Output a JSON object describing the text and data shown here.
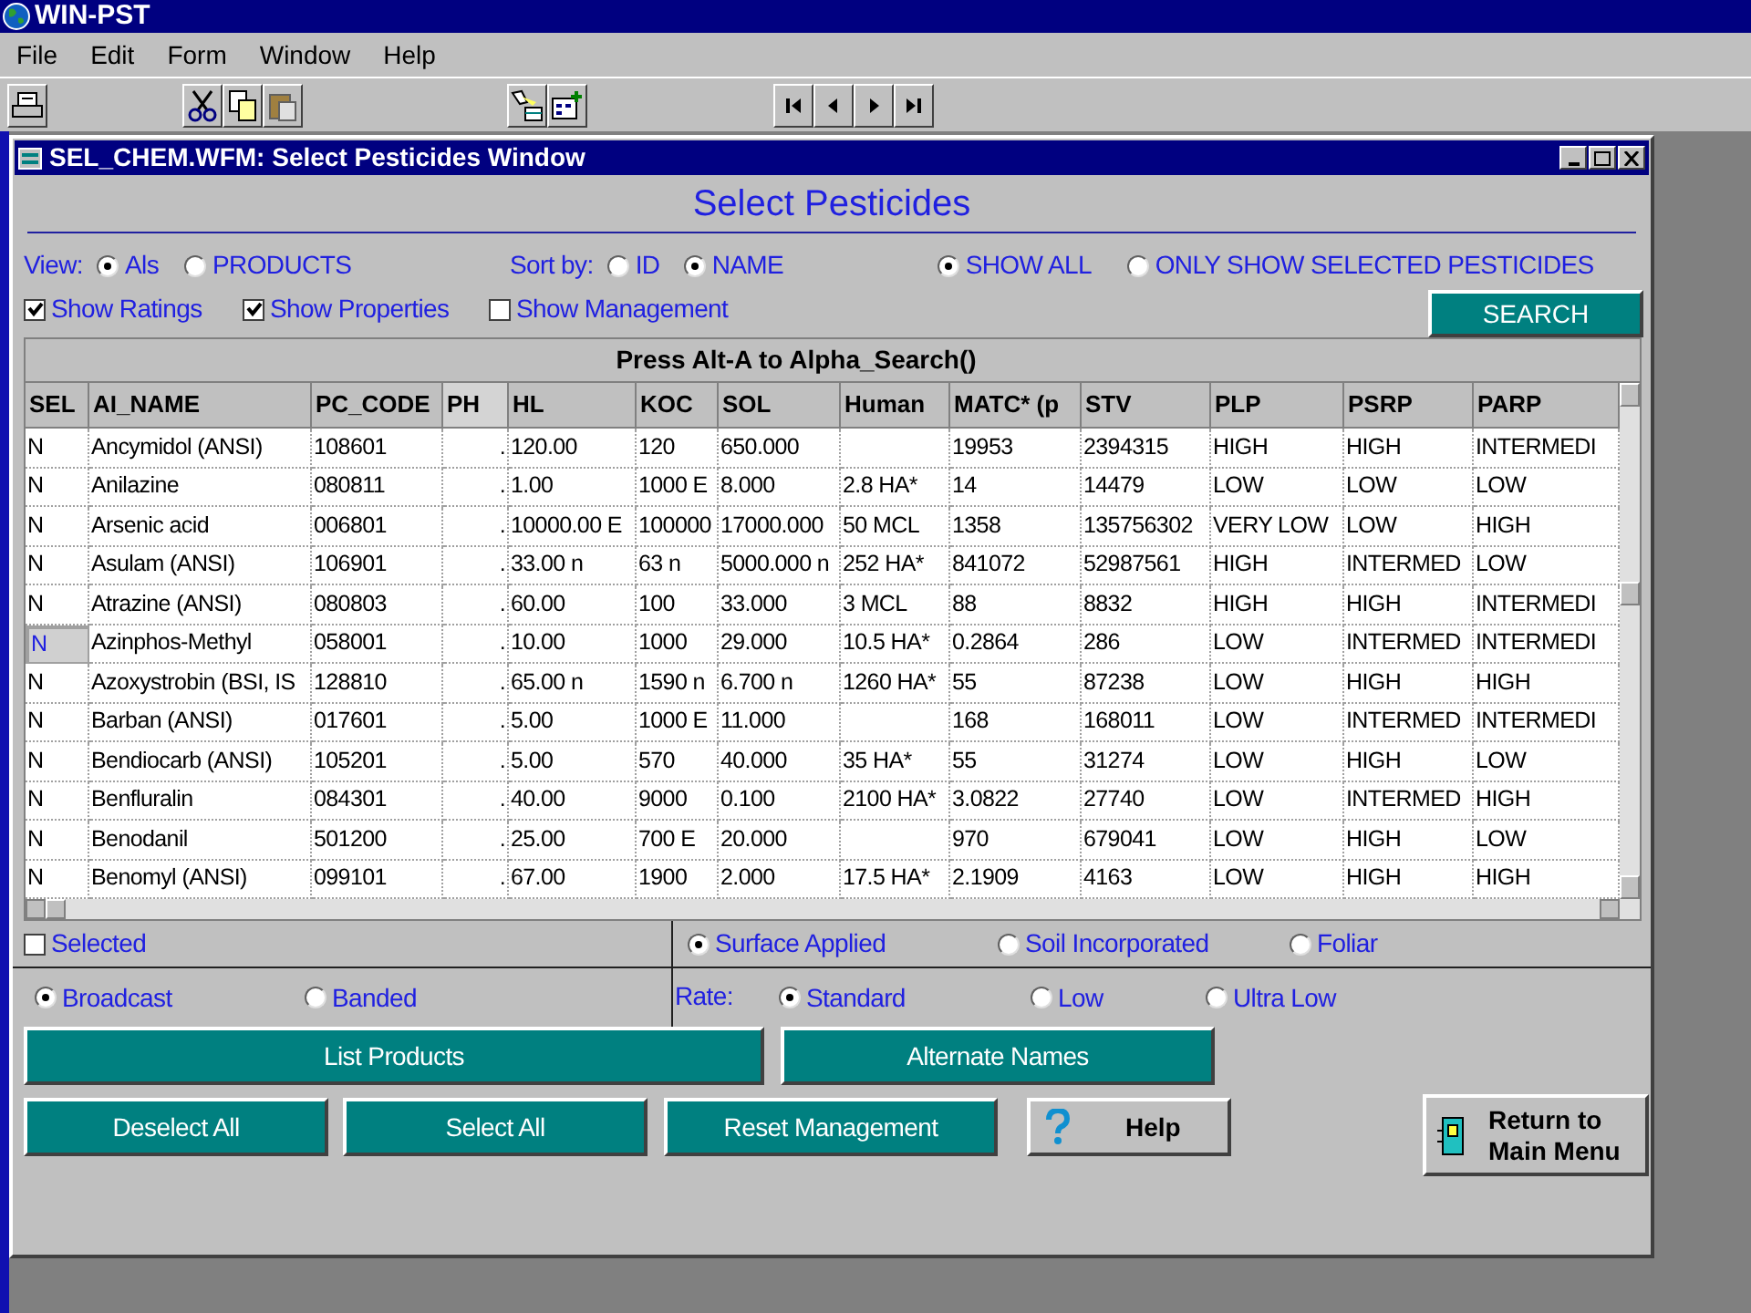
{
  "app": {
    "title": "WIN-PST"
  },
  "menu": [
    "File",
    "Edit",
    "Form",
    "Window",
    "Help"
  ],
  "window": {
    "title": "SEL_CHEM.WFM: Select Pesticides Window",
    "heading": "Select Pesticides"
  },
  "view": {
    "label": "View:",
    "options": [
      {
        "label": "Als",
        "selected": true
      },
      {
        "label": "PRODUCTS",
        "selected": false
      }
    ]
  },
  "sort": {
    "label": "Sort by:",
    "options": [
      {
        "label": "ID",
        "selected": false
      },
      {
        "label": "NAME",
        "selected": true
      }
    ]
  },
  "show": {
    "options": [
      {
        "label": "SHOW ALL",
        "selected": true
      },
      {
        "label": "ONLY SHOW SELECTED PESTICIDES",
        "selected": false
      }
    ]
  },
  "checkboxes": [
    {
      "label": "Show Ratings",
      "checked": true
    },
    {
      "label": "Show Properties",
      "checked": true
    },
    {
      "label": "Show Management",
      "checked": false
    }
  ],
  "search_button": "SEARCH",
  "grid": {
    "caption": "Press Alt-A to Alpha_Search()",
    "columns": [
      "SEL",
      "AI_NAME",
      "PC_CODE",
      "PH",
      "HL",
      "KOC",
      "SOL",
      "Human",
      "MATC* (p",
      "STV",
      "PLP",
      "PSRP",
      "PARP"
    ],
    "rows": [
      {
        "current": false,
        "cells": [
          "N",
          "Ancymidol (ANSI)",
          "108601",
          ".",
          "120.00",
          "120",
          "650.000",
          null,
          "19953",
          "2394315",
          "HIGH",
          "HIGH",
          "INTERMEDI"
        ]
      },
      {
        "current": false,
        "cells": [
          "N",
          "Anilazine",
          "080811",
          ".",
          "1.00",
          "1000 E",
          "8.000",
          "2.8 HA*",
          "14",
          "14479",
          "LOW",
          "LOW",
          "LOW"
        ]
      },
      {
        "current": false,
        "cells": [
          "N",
          "Arsenic acid",
          "006801",
          ".",
          "10000.00 E",
          "100000",
          "17000.000",
          "50 MCL",
          "1358",
          "135756302",
          "VERY LOW",
          "LOW",
          "HIGH"
        ]
      },
      {
        "current": false,
        "cells": [
          "N",
          "Asulam (ANSI)",
          "106901",
          ".",
          "33.00 n",
          "63 n",
          "5000.000 n",
          "252 HA*",
          "841072",
          "52987561",
          "HIGH",
          "INTERMED",
          "LOW"
        ]
      },
      {
        "current": false,
        "cells": [
          "N",
          "Atrazine (ANSI)",
          "080803",
          ".",
          "60.00",
          "100",
          "33.000",
          "3 MCL",
          "88",
          "8832",
          "HIGH",
          "HIGH",
          "INTERMEDI"
        ]
      },
      {
        "current": true,
        "cells": [
          "N",
          "Azinphos-Methyl",
          "058001",
          ".",
          "10.00",
          "1000",
          "29.000",
          "10.5 HA*",
          "0.2864",
          "286",
          "LOW",
          "INTERMED",
          "INTERMEDI"
        ]
      },
      {
        "current": false,
        "cells": [
          "N",
          "Azoxystrobin (BSI, IS",
          "128810",
          ".",
          "65.00 n",
          "1590 n",
          "6.700 n",
          "1260 HA*",
          "55",
          "87238",
          "LOW",
          "HIGH",
          "HIGH"
        ]
      },
      {
        "current": false,
        "cells": [
          "N",
          "Barban (ANSI)",
          "017601",
          ".",
          "5.00",
          "1000 E",
          "11.000",
          null,
          "168",
          "168011",
          "LOW",
          "INTERMED",
          "INTERMEDI"
        ]
      },
      {
        "current": false,
        "cells": [
          "N",
          "Bendiocarb (ANSI)",
          "105201",
          ".",
          "5.00",
          "570",
          "40.000",
          "35 HA*",
          "55",
          "31274",
          "LOW",
          "HIGH",
          "LOW"
        ]
      },
      {
        "current": false,
        "cells": [
          "N",
          "Benfluralin",
          "084301",
          ".",
          "40.00",
          "9000",
          "0.100",
          "2100 HA*",
          "3.0822",
          "27740",
          "LOW",
          "INTERMED",
          "HIGH"
        ]
      },
      {
        "current": false,
        "cells": [
          "N",
          "Benodanil",
          "501200",
          ".",
          "25.00",
          "700 E",
          "20.000",
          null,
          "970",
          "679041",
          "LOW",
          "HIGH",
          "LOW"
        ]
      },
      {
        "current": false,
        "cells": [
          "N",
          "Benomyl (ANSI)",
          "099101",
          ".",
          "67.00",
          "1900",
          "2.000",
          "17.5 HA*",
          "2.1909",
          "4163",
          "LOW",
          "HIGH",
          "HIGH"
        ]
      }
    ]
  },
  "selected_checkbox": {
    "label": "Selected",
    "checked": false
  },
  "application": [
    {
      "label": "Surface Applied",
      "selected": true
    },
    {
      "label": "Soil Incorporated",
      "selected": false
    },
    {
      "label": "Foliar",
      "selected": false
    }
  ],
  "method": [
    {
      "label": "Broadcast",
      "selected": true
    },
    {
      "label": "Banded",
      "selected": false
    }
  ],
  "rate": {
    "label": "Rate:",
    "options": [
      {
        "label": "Standard",
        "selected": true
      },
      {
        "label": "Low",
        "selected": false
      },
      {
        "label": "Ultra Low",
        "selected": false
      }
    ]
  },
  "button_rows": [
    [
      "List Products",
      "Alternate Names"
    ],
    [
      "Deselect All",
      "Select All",
      "Reset Management"
    ]
  ],
  "help_button": "Help",
  "return_button": "Return to Main Menu"
}
